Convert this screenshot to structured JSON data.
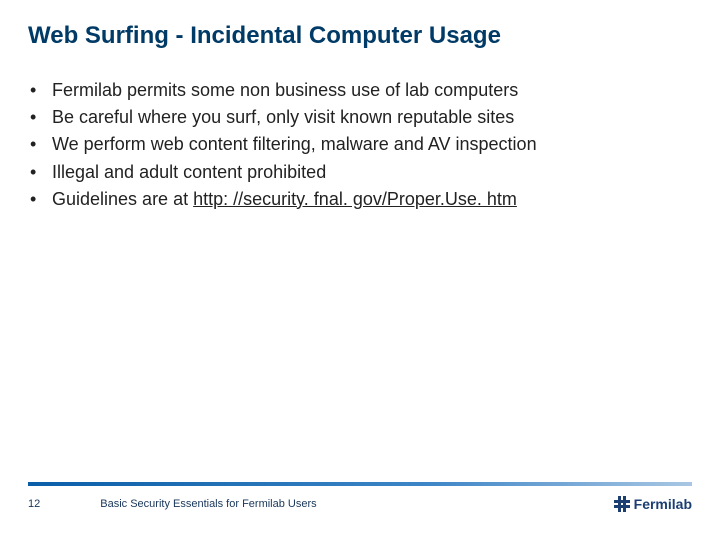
{
  "title": "Web Surfing - Incidental Computer Usage",
  "bullets": [
    {
      "text": "Fermilab permits some non business use of lab computers"
    },
    {
      "text": "Be careful where you surf, only visit known reputable sites"
    },
    {
      "text": "We perform web content filtering, malware and AV inspection"
    },
    {
      "text": "Illegal and adult content prohibited"
    },
    {
      "prefix": "Guidelines are at ",
      "link": "http: //security. fnal. gov/Proper.Use. htm"
    }
  ],
  "footer": {
    "page": "12",
    "title": "Basic Security Essentials for Fermilab Users",
    "logo_text": "Fermilab"
  }
}
